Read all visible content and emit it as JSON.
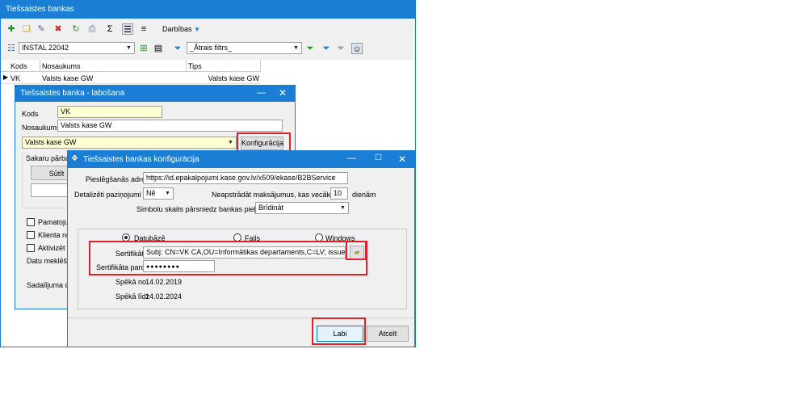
{
  "main_window": {
    "title": "Tiešsaistes bankas",
    "toolbar": {
      "darbibas_label": "Darbības"
    },
    "filter": {
      "company_value": "INSTAL 22042",
      "quick_filter_value": "_Ātrais filtrs_"
    },
    "table": {
      "headers": [
        "Kods",
        "Nosaukums",
        "Tips"
      ],
      "rows": [
        {
          "kods": "VK",
          "nosaukums": "Valsts kase GW",
          "tips": "Valsts kase GW"
        }
      ]
    }
  },
  "edit_dialog": {
    "title": "Tiešsaistes banka - labošana",
    "kods_label": "Kods",
    "kods_value": "VK",
    "nosaukums_label": "Nosaukums",
    "nosaukums_value": "Valsts kase GW",
    "type_value": "Valsts kase GW",
    "konfiguracija_button": "Konfigurācija",
    "sakaru_label": "Sakaru pārbaud",
    "sutit_button": "Sūtīt",
    "checkboxes": [
      "Pamatojum",
      "Klienta nosa",
      "Aktivizēt ne"
    ],
    "datu_label": "Datu meklēšana",
    "sadalijuma_label": "Sadalījuma dime"
  },
  "config_dialog": {
    "title": "Tiešsaistes bankas konfigurācija",
    "address_label": "Pieslēgšanās adrese",
    "address_value": "https://id.epakalpojumi.kase.gov.lv/x509/ekase/B2BService",
    "details_label": "Detalizēti paziņojumi",
    "details_value": "Nē",
    "unprocessed_label": "Neapstrādāt maksājumus, kas vecāki par",
    "unprocessed_value": "10",
    "unprocessed_unit": "dienām",
    "symbols_label": "Simbolu skaits pārsniedz bankas pieļaujamo",
    "symbols_value": "Brīdināt",
    "radio_options": [
      "Datubāzē",
      "Fails",
      "Windows"
    ],
    "radio_selected": "Datubāzē",
    "cert_label": "Sertifikāts",
    "cert_value": "Subj: CN=VK CA,OU=Informātikas departaments,C=LV; issuer: CN=VK CA,",
    "password_label": "Sertifikāta parole",
    "password_value": "●●●●●●●●",
    "valid_from_label": "Spēkā no",
    "valid_from_value": "14.02.2019",
    "valid_to_label": "Spēkā līdz",
    "valid_to_value": "14.02.2024",
    "ok_button": "Labi",
    "cancel_button": "Atcelt"
  },
  "colors": {
    "titlebar": "#1a7fd4",
    "highlight": "#e0202a",
    "field_yellow": "#ffffd4"
  }
}
